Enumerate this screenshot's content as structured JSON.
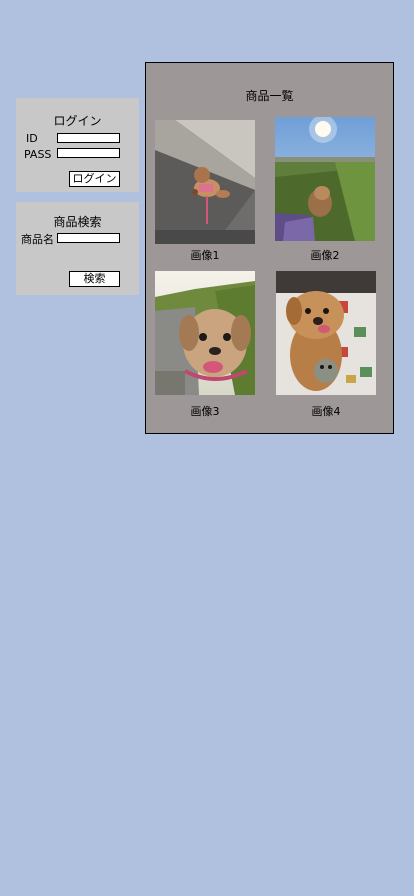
{
  "login": {
    "title": "ログイン",
    "id_label": "ID",
    "pass_label": "PASS",
    "id_value": "",
    "pass_value": "",
    "button_label": "ログイン"
  },
  "search": {
    "title": "商品検索",
    "name_label": "商品名",
    "name_value": "",
    "button_label": "検索"
  },
  "gallery": {
    "title": "商品一覧",
    "items": [
      {
        "caption": "画像1"
      },
      {
        "caption": "画像2"
      },
      {
        "caption": "画像3"
      },
      {
        "caption": "画像4"
      }
    ]
  }
}
